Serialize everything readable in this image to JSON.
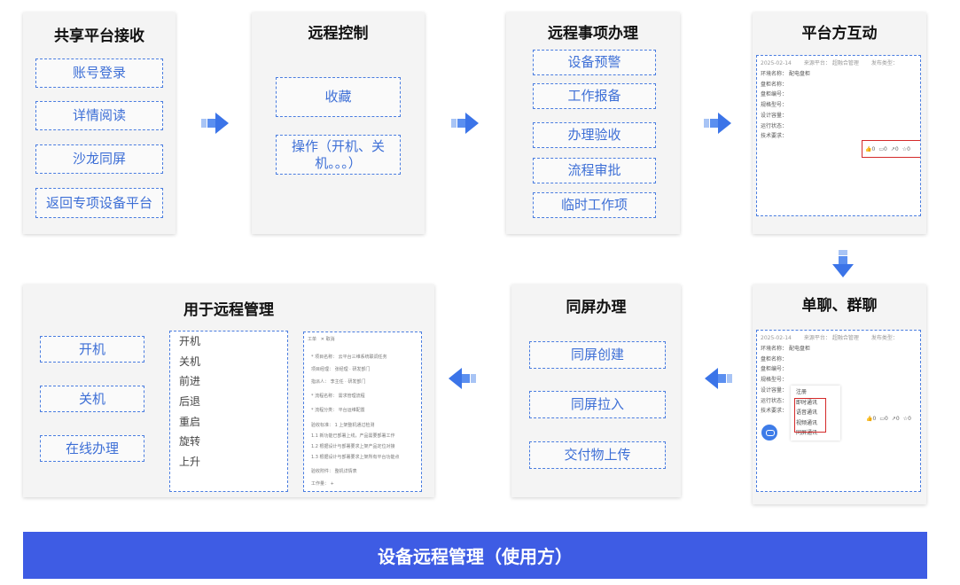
{
  "cards": {
    "receive": {
      "title": "共享平台接收",
      "items": [
        "账号登录",
        "详情阅读",
        "沙龙同屏",
        "返回专项设备平台"
      ]
    },
    "remote_control": {
      "title": "远程控制",
      "items": [
        "收藏",
        "操作（开机、关机。。。）"
      ]
    },
    "remote_affairs": {
      "title": "远程事项办理",
      "items": [
        "设备预警",
        "工作报备",
        "办理验收",
        "流程审批",
        "临时工作项"
      ]
    },
    "platform_interact": {
      "title": "平台方互动",
      "mini": {
        "date": "2025-02-14",
        "source": "来源平台：",
        "platform": "超融合管理",
        "publish": "发布类型：",
        "fields": [
          "环境名称：",
          "盘柜名称：",
          "盘柜编号：",
          "规格型号：",
          "设计容量：",
          "运行状态：",
          "技术要求："
        ],
        "env_value": "配电盘柜",
        "actions": [
          "0",
          "0",
          "0",
          "0"
        ]
      }
    },
    "chat": {
      "title": "单聊、群聊",
      "mini": {
        "date": "2025-02-14",
        "source": "来源平台：",
        "platform": "超融合管理",
        "publish": "发布类型：",
        "fields": [
          "环境名称：",
          "盘柜名称：",
          "盘柜编号：",
          "规格型号：",
          "设计容量：",
          "运行状态：",
          "技术要求："
        ],
        "env_value": "配电盘柜",
        "menu": [
          "注册",
          "即时通讯",
          "语音通讯",
          "视频通讯",
          "同屏通讯"
        ],
        "actions": [
          "0",
          "0",
          "0",
          "0"
        ]
      }
    },
    "same_screen": {
      "title": "同屏办理",
      "items": [
        "同屏创建",
        "同屏拉入",
        "交付物上传"
      ]
    },
    "remote_manage": {
      "title": "用于远程管理",
      "items": [
        "开机",
        "关机",
        "在线办理"
      ],
      "commands": [
        "开机",
        "关机",
        "前进",
        "后退",
        "重启",
        "旋转",
        "上升"
      ],
      "form": {
        "tabs": [
          "工单",
          "✕ 取消"
        ],
        "rows": [
          "* 项目名称：   云平台三维系统联调任务",
          "   项目经理：   张经理 · 研发部门",
          "   指派人：   李主任 · 研发部门",
          "* 流程名称：   需求管理流程",
          "* 流程分类：   平台运维配置",
          "   验收标准：   1      上架整机通过检测",
          "                 1.1    新功能已部署上线，产品需要部署工作",
          "                 1.2    根据设计与部署要求上架产品定位对接",
          "                 1.3    根据设计与部署要求上架所有平台功能点",
          "   验收附件：   整机详情表",
          "   工作量：   +"
        ]
      }
    }
  },
  "banner": "设备远程管理（使用方）",
  "colors": {
    "accent": "#3e5ce4",
    "dashed_border": "#4a7de0",
    "item_text": "#3d6fd6",
    "highlight": "#d42a2a"
  },
  "icons": [
    "arrow-right-icon",
    "arrow-down-icon",
    "arrow-left-icon",
    "like-icon",
    "comment-icon",
    "share-icon",
    "star-icon",
    "chat-bubble-icon"
  ]
}
